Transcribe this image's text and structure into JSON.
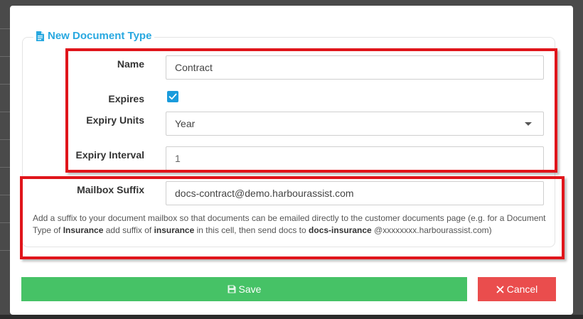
{
  "legend": {
    "title": "New Document Type",
    "icon": "document-icon"
  },
  "fields": {
    "name": {
      "label": "Name",
      "value": "Contract"
    },
    "expires": {
      "label": "Expires",
      "checked": true
    },
    "expiry_units": {
      "label": "Expiry Units",
      "value": "Year"
    },
    "expiry_interval": {
      "label": "Expiry Interval",
      "value": "1"
    },
    "mailbox_suffix": {
      "label": "Mailbox Suffix",
      "value": "docs-contract@demo.harbourassist.com"
    }
  },
  "help": {
    "part1": "Add a suffix to your document mailbox so that documents can be emailed directly to the customer documents page (e.g. for a Document Type of ",
    "bold1": "Insurance",
    "part2": " add suffix of ",
    "bold2": "insurance",
    "part3": " in this cell, then send docs to ",
    "bold3": "docs-insurance",
    "part4": " @xxxxxxxx.harbourassist.com)"
  },
  "buttons": {
    "save": {
      "label": "Save",
      "icon": "floppy-disk-icon"
    },
    "cancel": {
      "label": "Cancel",
      "icon": "close-icon"
    }
  },
  "colors": {
    "accent": "#28a8e0",
    "save": "#46c266",
    "cancel": "#ea4d4d",
    "highlight": "#e0151b"
  }
}
